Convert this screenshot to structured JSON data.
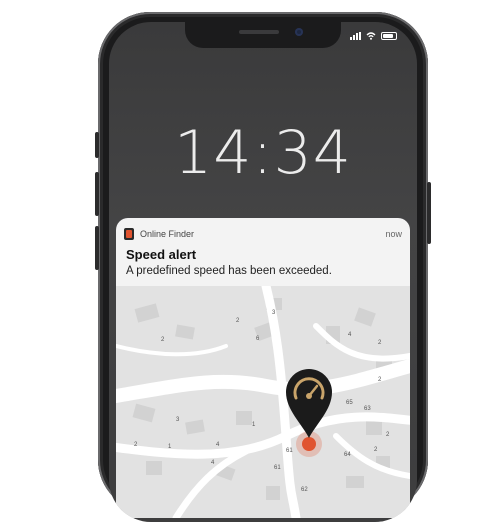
{
  "lockscreen": {
    "time": "14:34"
  },
  "notification": {
    "app_name": "Online Finder",
    "timestamp": "now",
    "title": "Speed alert",
    "message": "A predefined speed has been exceeded."
  },
  "map": {
    "house_numbers": [
      "3",
      "2",
      "6",
      "4",
      "2",
      "2",
      "2",
      "3",
      "1",
      "4",
      "2",
      "4",
      "61",
      "65",
      "61",
      "64",
      "2",
      "62",
      "2",
      "1",
      "63"
    ]
  },
  "colors": {
    "accent": "#e0532f",
    "pin": "#1b1b1b",
    "gauge": "#c9a46a"
  }
}
